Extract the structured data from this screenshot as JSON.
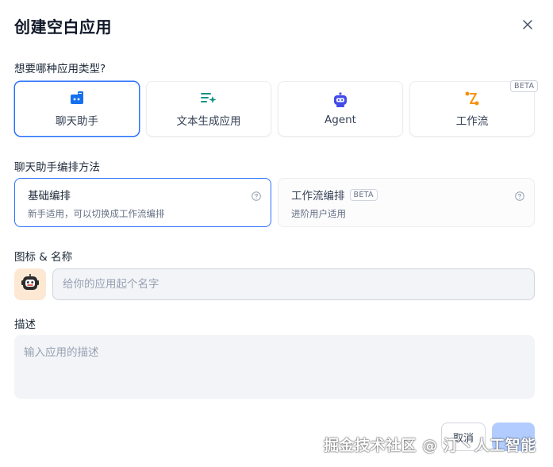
{
  "dialog": {
    "title": "创建空白应用",
    "close_icon": "close-icon"
  },
  "app_type": {
    "label": "想要哪种应用类型?",
    "cards": [
      {
        "label": "聊天助手",
        "icon": "chat-bot-icon",
        "selected": true,
        "beta": ""
      },
      {
        "label": "文本生成应用",
        "icon": "text-generation-icon",
        "selected": false,
        "beta": ""
      },
      {
        "label": "Agent",
        "icon": "agent-robot-icon",
        "selected": false,
        "beta": ""
      },
      {
        "label": "工作流",
        "icon": "workflow-icon",
        "selected": false,
        "beta": "BETA"
      }
    ]
  },
  "orchestration": {
    "label": "聊天助手编排方法",
    "options": [
      {
        "title": "基础编排",
        "desc": "新手适用，可以切换成工作流编排",
        "selected": true,
        "beta": ""
      },
      {
        "title": "工作流编排",
        "desc": "进阶用户适用",
        "selected": false,
        "beta": "BETA"
      }
    ]
  },
  "identity": {
    "label": "图标 & 名称",
    "avatar_icon": "robot-emoji-icon",
    "name_placeholder": "给你的应用起个名字"
  },
  "description": {
    "label": "描述",
    "placeholder": "输入应用的描述"
  },
  "footer": {
    "cancel_label": "取消",
    "create_label": ""
  },
  "watermark": "掘金技术社区 @ 汀丶人工智能",
  "colors": {
    "accent": "#2970ff",
    "chat_icon": "#1570ef",
    "text_gen_icon": "#0e9384",
    "agent_icon": "#444ce7",
    "workflow_icon": "#f79009",
    "avatar_bg": "#fde8d4"
  }
}
